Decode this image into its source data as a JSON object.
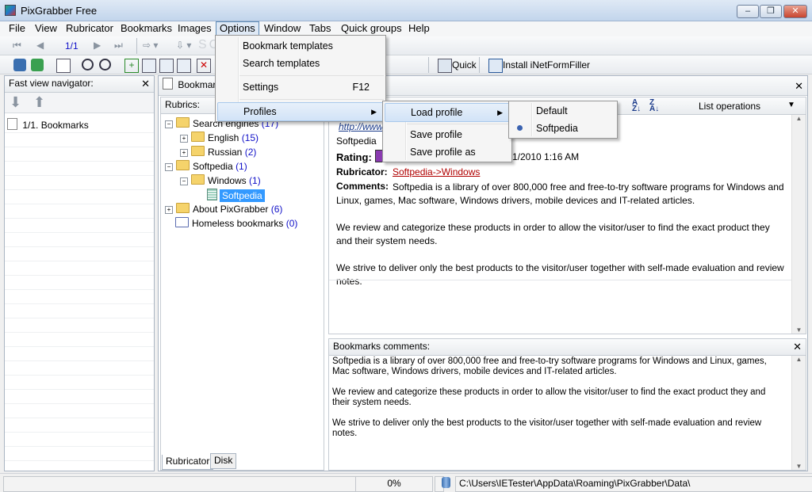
{
  "window": {
    "title": "PixGrabber Free",
    "watermark": "SOFTPEDIA",
    "controls": {
      "minimize": "‒",
      "maximize": "❐",
      "close": "✕"
    }
  },
  "menubar": {
    "items": [
      {
        "label": "File"
      },
      {
        "label": "View"
      },
      {
        "label": "Rubricator"
      },
      {
        "label": "Bookmarks"
      },
      {
        "label": "Images"
      },
      {
        "label": "Options"
      },
      {
        "label": "Window"
      },
      {
        "label": "Tabs"
      },
      {
        "label": "Quick groups"
      },
      {
        "label": "Help"
      }
    ],
    "active": "Options"
  },
  "toolbar1": {
    "page_indicator": "1/1"
  },
  "toolbar2": {
    "quick_label": "Quick",
    "install_label": "Install iNetFormFiller"
  },
  "navigator": {
    "title": "Fast view navigator:",
    "items": [
      {
        "label": "1/1. Bookmarks"
      }
    ]
  },
  "bookmarks_tab": {
    "title": "Bookmarks"
  },
  "rubrics": {
    "title": "Rubrics:",
    "tree": [
      {
        "label": "Search engines",
        "count": "(17)"
      },
      {
        "label": "English",
        "count": "(15)"
      },
      {
        "label": "Russian",
        "count": "(2)"
      },
      {
        "label": "Softpedia",
        "count": "(1)"
      },
      {
        "label": "Windows",
        "count": "(1)"
      },
      {
        "label": "Softpedia",
        "count": ""
      },
      {
        "label": "About PixGrabber",
        "count": "(6)"
      },
      {
        "label": "Homeless bookmarks",
        "count": "(0)"
      }
    ],
    "tabs": [
      "Rubricator",
      "Disk"
    ]
  },
  "details": {
    "list_operations": "List operations",
    "url": "http://www.s",
    "name": "Softpedia",
    "rating_label": "Rating:",
    "date": "1/2010 1:16 AM",
    "rubricator_label": "Rubricator:",
    "rubricator_value": "Softpedia->Windows",
    "comments_label": "Comments:",
    "comments_p1": "Softpedia is a library of over 800,000 free and free-to-try software programs for Windows and Linux, games, Mac software, Windows drivers, mobile devices and IT-related articles.",
    "comments_p2": "We review and categorize these products in order to allow the visitor/user to find the exact product they and their system needs.",
    "comments_p3": "We strive to deliver only the best products to the visitor/user together with self-made evaluation and review notes."
  },
  "bm_comments": {
    "title": "Bookmarks comments:",
    "p1": "Softpedia is a library of over 800,000 free and free-to-try software programs for Windows and Linux, games, Mac software, Windows drivers, mobile devices and IT-related articles.",
    "p2": "We review and categorize these products in order to allow the visitor/user to find the exact product they and their system needs.",
    "p3": "We strive to deliver only the best products to the visitor/user together with self-made evaluation and review notes."
  },
  "options_menu": {
    "items": [
      {
        "label": "Bookmark templates",
        "shortcut": ""
      },
      {
        "label": "Search templates",
        "shortcut": ""
      },
      {
        "label": "Settings",
        "shortcut": "F12"
      },
      {
        "label": "Profiles",
        "shortcut": ""
      }
    ]
  },
  "profiles_menu": {
    "items": [
      {
        "label": "Load profile"
      },
      {
        "label": "Save profile"
      },
      {
        "label": "Save profile as"
      }
    ]
  },
  "load_profile_menu": {
    "items": [
      {
        "label": "Default"
      },
      {
        "label": "Softpedia"
      }
    ],
    "selected": "Softpedia"
  },
  "statusbar": {
    "progress": "0%",
    "path": "C:\\Users\\IETester\\AppData\\Roaming\\PixGrabber\\Data\\"
  },
  "colors": {
    "accent": "#5f8bb8",
    "link": "#b00000",
    "count": "#1010c8",
    "selection": "#3399ff"
  }
}
